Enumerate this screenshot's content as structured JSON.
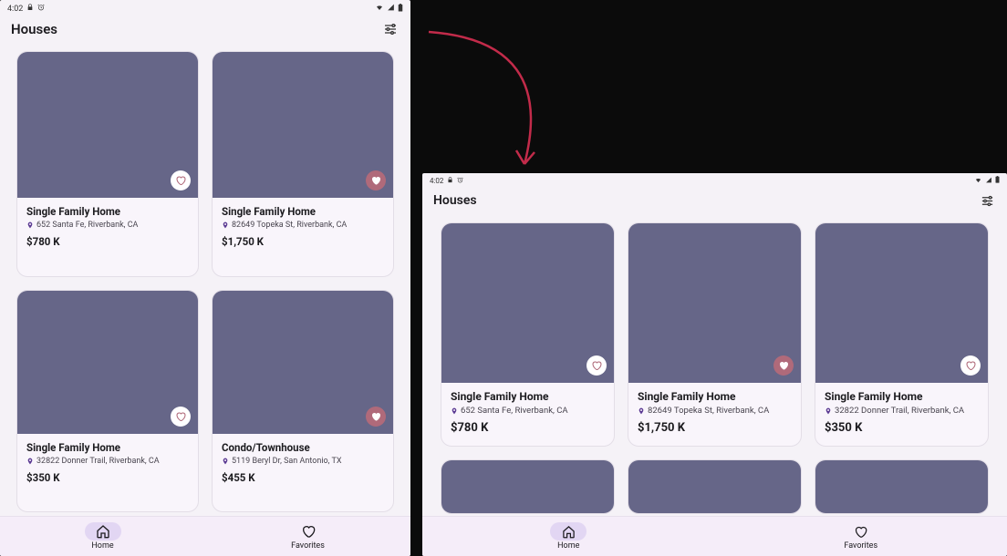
{
  "status": {
    "time": "4:02"
  },
  "header": {
    "title": "Houses"
  },
  "nav": {
    "home_label": "Home",
    "favorites_label": "Favorites"
  },
  "phone_cards": [
    {
      "title": "Single Family Home",
      "address": "652 Santa Fe, Riverbank, CA",
      "price": "$780 K",
      "favorite": false
    },
    {
      "title": "Single Family Home",
      "address": "82649 Topeka St, Riverbank, CA",
      "price": "$1,750 K",
      "favorite": true
    },
    {
      "title": "Single Family Home",
      "address": "32822 Donner Trail, Riverbank, CA",
      "price": "$350 K",
      "favorite": false
    },
    {
      "title": "Condo/Townhouse",
      "address": "5119 Beryl Dr, San Antonio, TX",
      "price": "$455 K",
      "favorite": true
    }
  ],
  "tablet_cards": [
    {
      "title": "Single Family Home",
      "address": "652 Santa Fe, Riverbank, CA",
      "price": "$780 K",
      "favorite": false
    },
    {
      "title": "Single Family Home",
      "address": "82649 Topeka St, Riverbank, CA",
      "price": "$1,750 K",
      "favorite": true
    },
    {
      "title": "Single Family Home",
      "address": "32822 Donner Trail, Riverbank, CA",
      "price": "$350 K",
      "favorite": false
    }
  ]
}
